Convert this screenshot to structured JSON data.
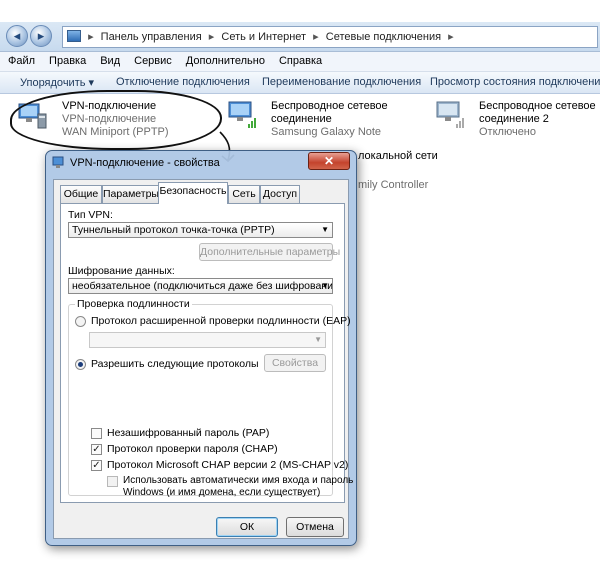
{
  "address": {
    "crumb1": "Панель управления",
    "crumb2": "Сеть и Интернет",
    "crumb3": "Сетевые подключения",
    "sep": "▸"
  },
  "menu": [
    "Файл",
    "Правка",
    "Вид",
    "Сервис",
    "Дополнительно",
    "Справка"
  ],
  "commands": {
    "organize": "Упорядочить ▾",
    "disconnect": "Отключение подключения",
    "rename": "Переименование подключения",
    "status": "Просмотр состояния подключения"
  },
  "connections": [
    {
      "name": "VPN-подключение",
      "line2": "VPN-подключение",
      "line3": "WAN Miniport (PPTP)"
    },
    {
      "name": "Беспроводное сетевое",
      "line2": "соединение",
      "line3": "Samsung Galaxy Note"
    },
    {
      "name": "Беспроводное сетевое",
      "line2": "соединение 2",
      "line3": "Отключено"
    }
  ],
  "partial": {
    "lan": "локальной сети",
    "controller": "mily Controller"
  },
  "dialog": {
    "title": "VPN-подключение - свойства",
    "close": "✕",
    "tabs": [
      "Общие",
      "Параметры",
      "Безопасность",
      "Сеть",
      "Доступ"
    ],
    "vpn_type_label": "Тип VPN:",
    "vpn_type_value": "Туннельный протокол точка-точка (PPTP)",
    "advanced_button": "Дополнительные параметры",
    "encryption_label": "Шифрование данных:",
    "encryption_value": "необязательное (подключиться даже без шифрования)",
    "auth_group": "Проверка подлинности",
    "eap_option": "Протокол расширенной проверки подлинности (EAP)",
    "allow_option": "Разрешить следующие протоколы",
    "properties_button": "Свойства",
    "pap": "Незашифрованный пароль (PAP)",
    "chap": "Протокол проверки пароля (CHAP)",
    "mschap": "Протокол Microsoft CHAP версии 2 (MS-CHAP v2)",
    "auto_line1": "Использовать автоматически имя входа и пароль",
    "auto_line2": "Windows (и имя домена, если существует)",
    "ok": "ОК",
    "cancel": "Отмена"
  },
  "state": {
    "pap": false,
    "chap": true,
    "mschap": true,
    "auto": false,
    "eap_selected": false,
    "allow_selected": true
  }
}
